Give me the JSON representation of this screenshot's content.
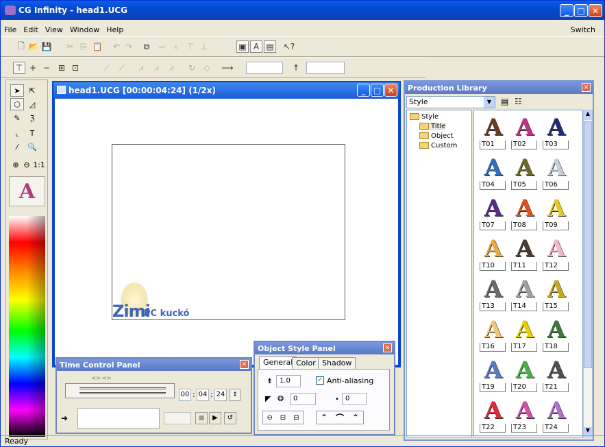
{
  "window": {
    "title": "CG Infinity - head1.UCG"
  },
  "menu": {
    "items": [
      "File",
      "Edit",
      "View",
      "Window",
      "Help"
    ],
    "right": "Switch"
  },
  "child": {
    "title": "head1.UCG [00:00:04:24]  (1/2x)"
  },
  "watermark": {
    "text": "Zimi",
    "suffix": "PC kuckó"
  },
  "palette": {
    "preview": "A"
  },
  "time_panel": {
    "title": "Time Control Panel",
    "hours": "00",
    "minutes": "04",
    "frames": "24"
  },
  "style_panel": {
    "title": "Object Style Panel",
    "tabs": [
      "General",
      "Color",
      "Shadow"
    ],
    "thickness": "1.0",
    "antialias_label": "Anti-aliasing",
    "value_a": "0",
    "value_b": "0"
  },
  "library": {
    "title": "Production Library",
    "dropdown": "Style",
    "tree": {
      "root": "Style",
      "items": [
        "Title",
        "Object",
        "Custom"
      ]
    },
    "items": [
      {
        "label": "T01",
        "color": "#6a3b1e"
      },
      {
        "label": "T02",
        "color": "#c02f88"
      },
      {
        "label": "T03",
        "color": "#1e2a7a"
      },
      {
        "label": "T04",
        "color": "#2d6fb8"
      },
      {
        "label": "T05",
        "color": "#6b6a2a"
      },
      {
        "label": "T06",
        "color": "#c7cdd6"
      },
      {
        "label": "T07",
        "color": "#5a2a8a"
      },
      {
        "label": "T08",
        "color": "#e0501c"
      },
      {
        "label": "T09",
        "color": "#e8c820"
      },
      {
        "label": "T10",
        "color": "#e8a848"
      },
      {
        "label": "T11",
        "color": "#4a3a30"
      },
      {
        "label": "T12",
        "color": "#f2b6cf"
      },
      {
        "label": "T13",
        "color": "#6a6a6a"
      },
      {
        "label": "T14",
        "color": "#a0a0a0"
      },
      {
        "label": "T15",
        "color": "#c8a820"
      },
      {
        "label": "T16",
        "color": "#f0c878"
      },
      {
        "label": "T17",
        "color": "#e8d000"
      },
      {
        "label": "T18",
        "color": "#3e7a3e"
      },
      {
        "label": "T19",
        "color": "#5a7ac0"
      },
      {
        "label": "T20",
        "color": "#48b048"
      },
      {
        "label": "T21",
        "color": "#505050"
      },
      {
        "label": "T22",
        "color": "#e02838"
      },
      {
        "label": "T23",
        "color": "#d050a8"
      },
      {
        "label": "T24",
        "color": "#b070c8"
      }
    ]
  },
  "status": {
    "text": "Ready"
  }
}
